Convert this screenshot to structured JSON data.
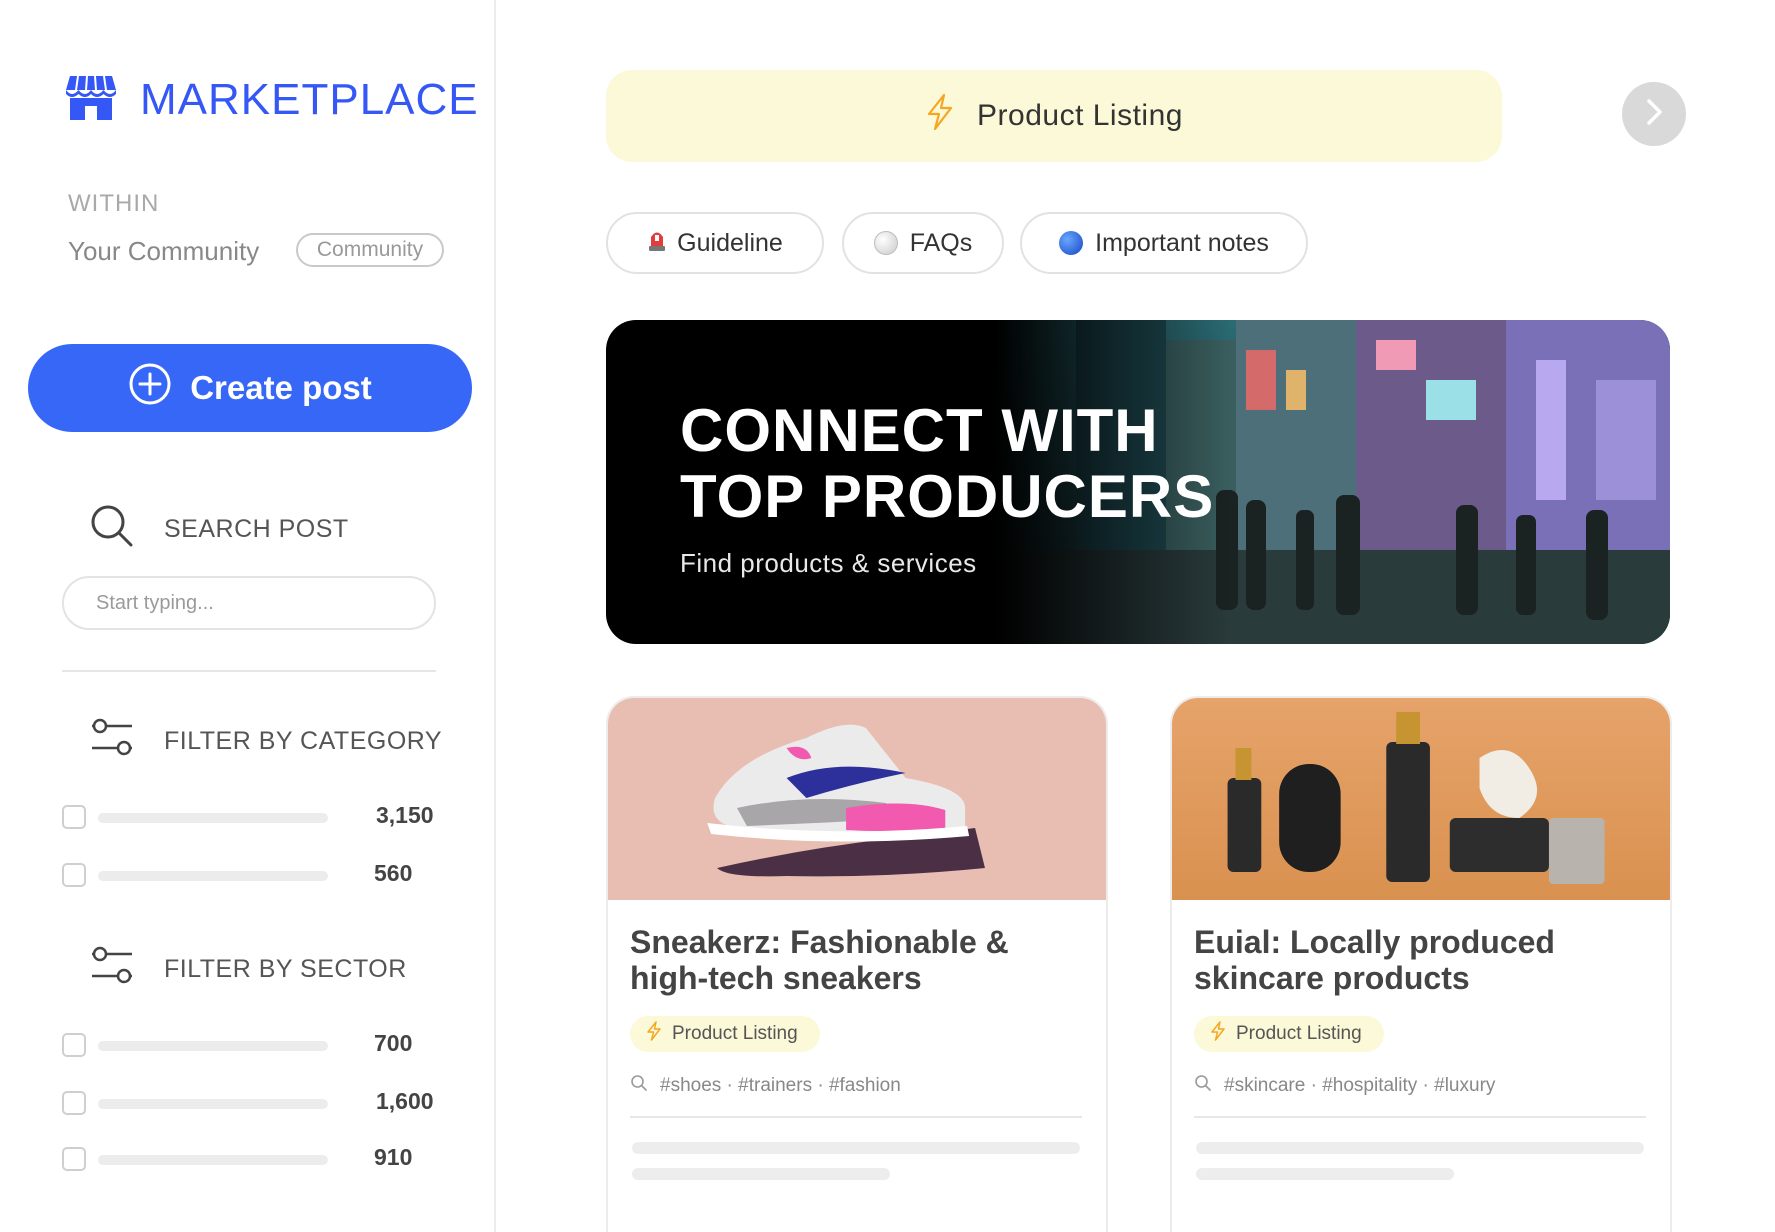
{
  "sidebar": {
    "brand": "MARKETPLACE",
    "within_label": "WITHIN",
    "community_name": "Your Community",
    "community_pill": "Community",
    "create_post": "Create post",
    "search_title": "SEARCH POST",
    "search_placeholder": "Start typing...",
    "category_title": "FILTER BY CATEGORY",
    "categories": [
      {
        "count": "3,150"
      },
      {
        "count": "560"
      }
    ],
    "sector_title": "FILTER BY SECTOR",
    "sectors": [
      {
        "count": "700"
      },
      {
        "count": "1,600"
      },
      {
        "count": "910"
      }
    ]
  },
  "main": {
    "banner": "Product Listing",
    "tabs": [
      {
        "label": "Guideline",
        "icon": "siren-icon"
      },
      {
        "label": "FAQs",
        "icon": "white-circle-icon"
      },
      {
        "label": "Important notes",
        "icon": "blue-circle-icon"
      }
    ],
    "hero": {
      "title_line1": "CONNECT WITH",
      "title_line2": "TOP PRODUCERS",
      "subtitle": "Find products & services"
    },
    "cards": [
      {
        "title": "Sneakerz: Fashionable & high-tech sneakers",
        "badge": "Product Listing",
        "tags": "#shoes · #trainers · #fashion"
      },
      {
        "title": "Euial: Locally produced skincare products",
        "badge": "Product Listing",
        "tags": "#skincare · #hospitality · #luxury"
      }
    ]
  },
  "colors": {
    "accent": "#3767f7",
    "brand": "#3457f5",
    "banner_bg": "#fcf9d8",
    "bolt": "#f5a623"
  }
}
